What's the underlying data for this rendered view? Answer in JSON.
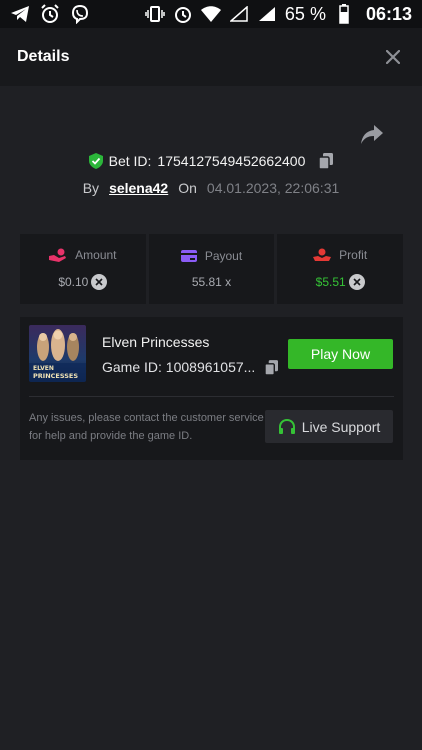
{
  "status_bar": {
    "battery_percent": "65 %",
    "time": "06:13"
  },
  "header": {
    "title": "Details"
  },
  "bet": {
    "id_label": "Bet ID:",
    "id_value": "1754127549452662400",
    "by_label": "By",
    "username": "selena42",
    "on_label": "On",
    "date": "04.01.2023, 22:06:31"
  },
  "stats": [
    {
      "label": "Amount",
      "value": "$0.10",
      "color": "#e8336a",
      "has_x": true
    },
    {
      "label": "Payout",
      "value": "55.81 x",
      "color": "#8b5cf6",
      "has_x": false
    },
    {
      "label": "Profit",
      "value": "$5.51",
      "color": "#e53935",
      "has_x": true
    }
  ],
  "game": {
    "title": "Elven Princesses",
    "id_label": "Game ID: 1008961057...",
    "play_label": "Play Now",
    "thumb_text_1": "ELVEN",
    "thumb_text_2": "PRINCESSES"
  },
  "support": {
    "message": "Any issues, please contact the customer service for help and provide the game ID.",
    "button_label": "Live Support"
  },
  "colors": {
    "accent": "#34b728",
    "profit": "#35c236",
    "background": "#1f2024"
  }
}
